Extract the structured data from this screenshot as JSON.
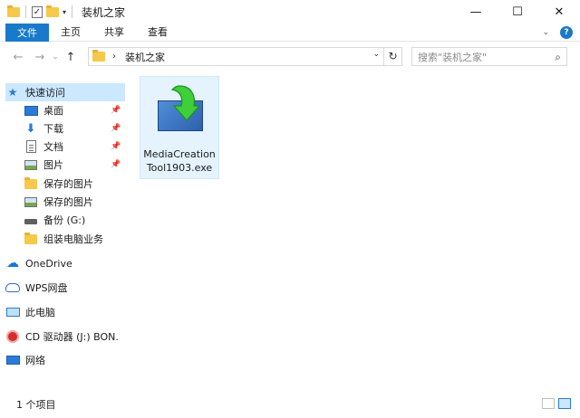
{
  "window": {
    "title": "装机之家",
    "controls": {
      "minimize": "—",
      "maximize": "☐",
      "close": "✕"
    }
  },
  "ribbon": {
    "tabs": [
      "文件",
      "主页",
      "共享",
      "查看"
    ],
    "collapse_glyph": "⌄",
    "help_glyph": "?"
  },
  "address": {
    "path": "装机之家",
    "separator_glyph": "›",
    "search_placeholder": "搜索\"装机之家\""
  },
  "sidebar": {
    "quick_access": "快速访问",
    "items": [
      {
        "label": "桌面",
        "icon": "desktop-icon",
        "pinned": true
      },
      {
        "label": "下载",
        "icon": "download-icon",
        "pinned": true
      },
      {
        "label": "文档",
        "icon": "document-icon",
        "pinned": true
      },
      {
        "label": "图片",
        "icon": "pictures-icon",
        "pinned": true
      },
      {
        "label": "保存的图片",
        "icon": "folder-icon",
        "pinned": false
      },
      {
        "label": "保存的图片",
        "icon": "pictures-icon",
        "pinned": false
      },
      {
        "label": "备份 (G:)",
        "icon": "drive-icon",
        "pinned": false
      },
      {
        "label": "组装电脑业务",
        "icon": "folder-icon",
        "pinned": false
      }
    ],
    "onedrive": "OneDrive",
    "wps": "WPS网盘",
    "this_pc": "此电脑",
    "cd_drive": "CD 驱动器 (J:) BON.",
    "network": "网络"
  },
  "content": {
    "files": [
      {
        "name_line1": "MediaCreation",
        "name_line2": "Tool1903.exe",
        "icon": "installer-icon"
      }
    ]
  },
  "status": {
    "item_count": "1 个项目"
  },
  "colors": {
    "accent": "#1979ca",
    "selection": "#cce8ff",
    "hover": "#e5f3ff",
    "folder": "#f6c94b"
  }
}
